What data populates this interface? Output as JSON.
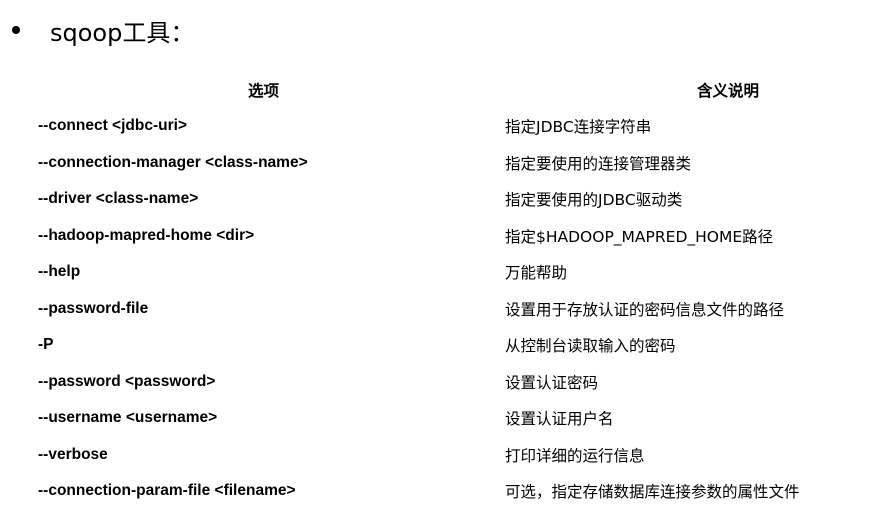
{
  "heading": "sqoop工具：",
  "table": {
    "headers": {
      "option": "选项",
      "description": "含义说明"
    },
    "rows": [
      {
        "option": "--connect <jdbc-uri>",
        "description": "指定JDBC连接字符串"
      },
      {
        "option": "--connection-manager <class-name>",
        "description": "指定要使用的连接管理器类"
      },
      {
        "option": "--driver <class-name>",
        "description": "指定要使用的JDBC驱动类"
      },
      {
        "option": "--hadoop-mapred-home <dir>",
        "description": "指定$HADOOP_MAPRED_HOME路径"
      },
      {
        "option": "--help",
        "description": "万能帮助"
      },
      {
        "option": "--password-file",
        "description": "设置用于存放认证的密码信息文件的路径"
      },
      {
        "option": "-P",
        "description": "从控制台读取输入的密码"
      },
      {
        "option": "--password <password>",
        "description": "设置认证密码"
      },
      {
        "option": "--username <username>",
        "description": "设置认证用户名"
      },
      {
        "option": "--verbose",
        "description": "打印详细的运行信息"
      },
      {
        "option": "--connection-param-file <filename>",
        "description": "可选，指定存储数据库连接参数的属性文件"
      }
    ]
  }
}
